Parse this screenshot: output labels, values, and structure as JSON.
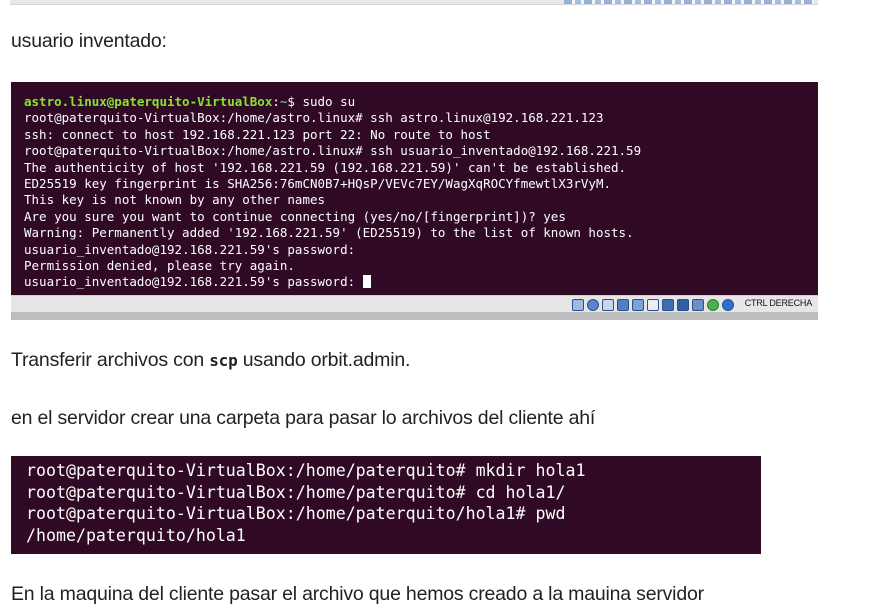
{
  "paragraphs": {
    "p1": "usuario inventado:",
    "p2_before": "Transferir archivos con ",
    "p2_code": "scp",
    "p2_after": " usando orbit.admin.",
    "p3": "en el servidor crear una carpeta para pasar lo archivos del cliente ahí",
    "p4": "En la maquina del cliente pasar el archivo que hemos creado a la mauina servidor"
  },
  "terminal1": {
    "prompt_user": "astro.linux@paterquito-VirtualBox",
    "prompt_sep": ":",
    "prompt_path": "~",
    "prompt_cmd": "$ sudo su",
    "lines": [
      "root@paterquito-VirtualBox:/home/astro.linux# ssh astro.linux@192.168.221.123",
      "ssh: connect to host 192.168.221.123 port 22: No route to host",
      "root@paterquito-VirtualBox:/home/astro.linux# ssh usuario_inventado@192.168.221.59",
      "The authenticity of host '192.168.221.59 (192.168.221.59)' can't be established.",
      "ED25519 key fingerprint is SHA256:76mCN0B7+HQsP/VEVc7EY/WagXqROCYfmewtlX3rVyM.",
      "This key is not known by any other names",
      "Are you sure you want to continue connecting (yes/no/[fingerprint])? yes",
      "Warning: Permanently added '192.168.221.59' (ED25519) to the list of known hosts.",
      "usuario_inventado@192.168.221.59's password:",
      "Permission denied, please try again."
    ],
    "last_line": "usuario_inventado@192.168.221.59's password: "
  },
  "vm_statusbar": {
    "host_key_label": "CTRL DERECHA",
    "icons": [
      "hard-disk-icon",
      "optical-disk-icon",
      "audio-icon",
      "network-icon",
      "usb-icon",
      "shared-folder-icon",
      "display-icon",
      "video-capture-icon",
      "cpu-icon",
      "mouse-integration-icon",
      "keyboard-icon"
    ]
  },
  "terminal2": {
    "lines": [
      "root@paterquito-VirtualBox:/home/paterquito# mkdir hola1",
      "root@paterquito-VirtualBox:/home/paterquito# cd hola1/",
      "root@paterquito-VirtualBox:/home/paterquito/hola1# pwd",
      "/home/paterquito/hola1"
    ]
  },
  "colors": {
    "terminal_bg": "#300a24",
    "prompt_user": "#8ae234",
    "prompt_path": "#729fcf",
    "text": "#222222"
  }
}
